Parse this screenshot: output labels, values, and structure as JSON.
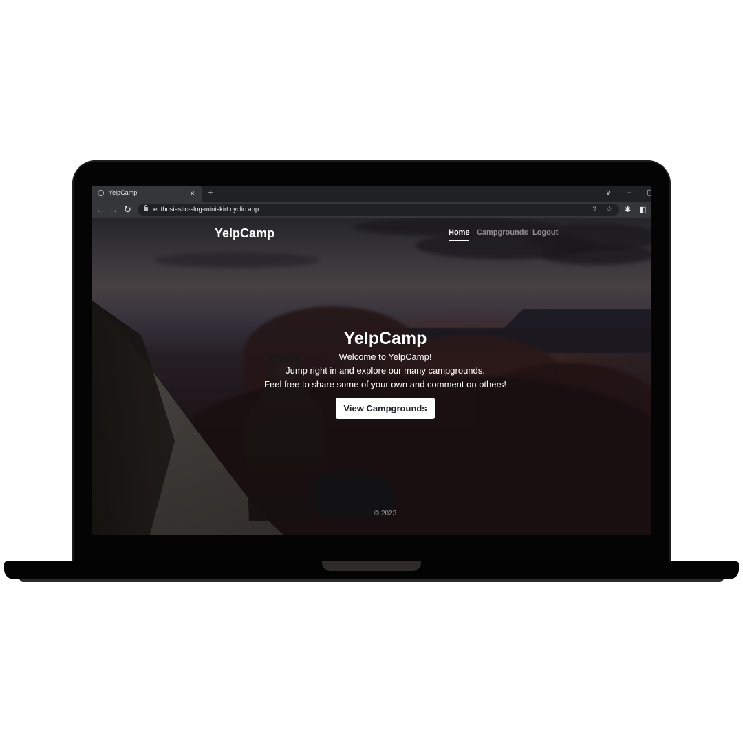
{
  "browser": {
    "tab_title": "YelpCamp",
    "tab_close": "×",
    "new_tab": "+",
    "url": "enthusiastic-slug-miniskirt.cyclic.app",
    "window_controls": [
      "∨",
      "–",
      "▢"
    ],
    "nav_icons": [
      "back-arrow-icon",
      "forward-arrow-icon",
      "reload-icon"
    ]
  },
  "site": {
    "brand": "YelpCamp",
    "nav": [
      "Home",
      "Campgrounds",
      "Logout"
    ],
    "active_nav": "Home"
  },
  "hero": {
    "title": "YelpCamp",
    "line1": "Welcome to YelpCamp!",
    "line2": "Jump right in and explore our many campgrounds.",
    "line3": "Feel free to share some of your own and comment on others!",
    "button": "View Campgrounds"
  },
  "footer": {
    "copyright": "© 2023"
  }
}
